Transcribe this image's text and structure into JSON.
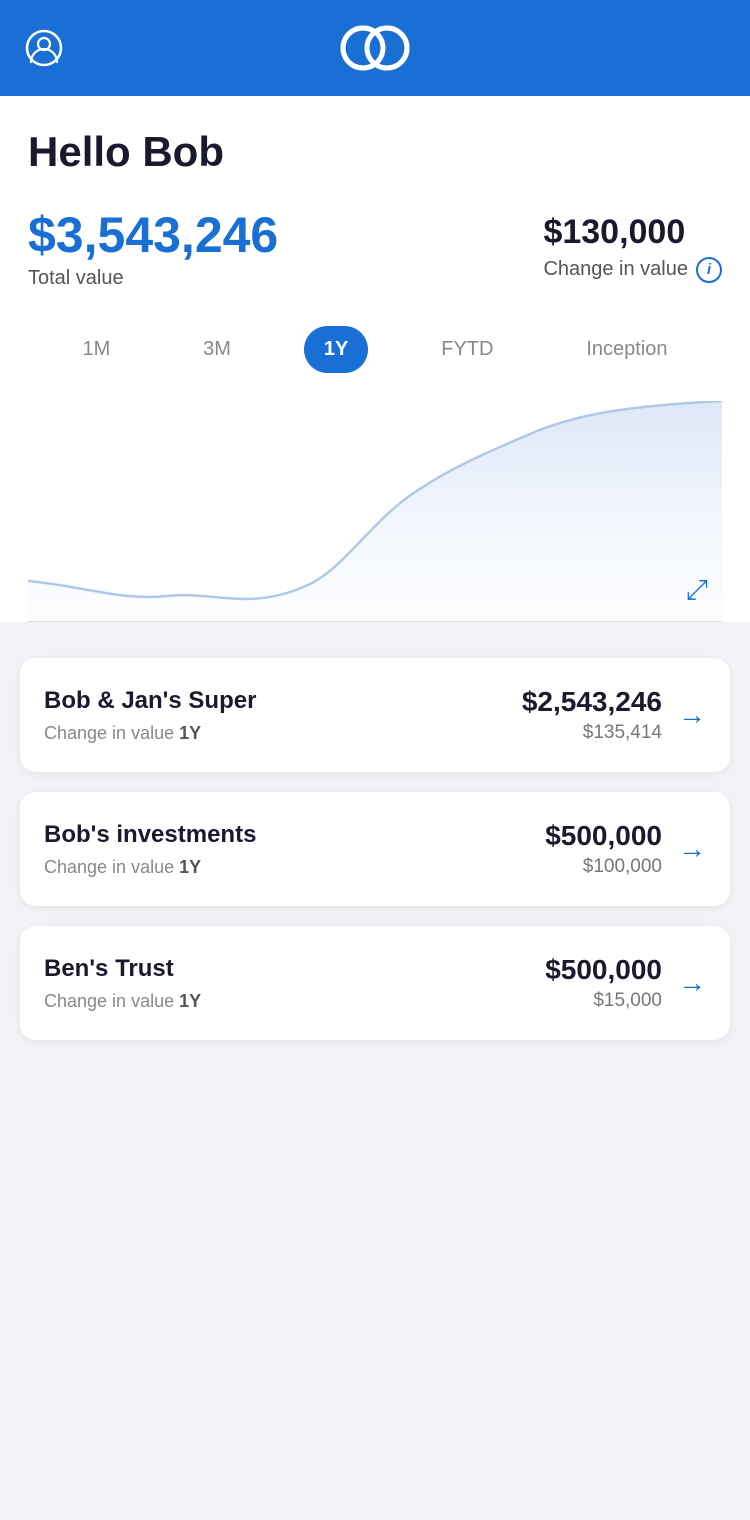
{
  "header": {
    "logo_label": "Logo",
    "profile_label": "User Profile"
  },
  "greeting": "Hello Bob",
  "total_value": {
    "amount": "$3,543,246",
    "label": "Total value"
  },
  "change_value": {
    "amount": "$130,000",
    "label": "Change in value"
  },
  "time_tabs": [
    {
      "id": "1m",
      "label": "1M",
      "active": false
    },
    {
      "id": "3m",
      "label": "3M",
      "active": false
    },
    {
      "id": "1y",
      "label": "1Y",
      "active": true
    },
    {
      "id": "fytd",
      "label": "FYTD",
      "active": false
    },
    {
      "id": "inception",
      "label": "Inception",
      "active": false
    }
  ],
  "expand_icon": "⤢",
  "accounts": [
    {
      "name": "Bob & Jan's Super",
      "change_label": "Change in value",
      "change_period": "1Y",
      "main_value": "$2,543,246",
      "change_value": "$135,414"
    },
    {
      "name": "Bob's investments",
      "change_label": "Change in value",
      "change_period": "1Y",
      "main_value": "$500,000",
      "change_value": "$100,000"
    },
    {
      "name": "Ben's Trust",
      "change_label": "Change in value",
      "change_period": "1Y",
      "main_value": "$500,000",
      "change_value": "$15,000"
    }
  ]
}
